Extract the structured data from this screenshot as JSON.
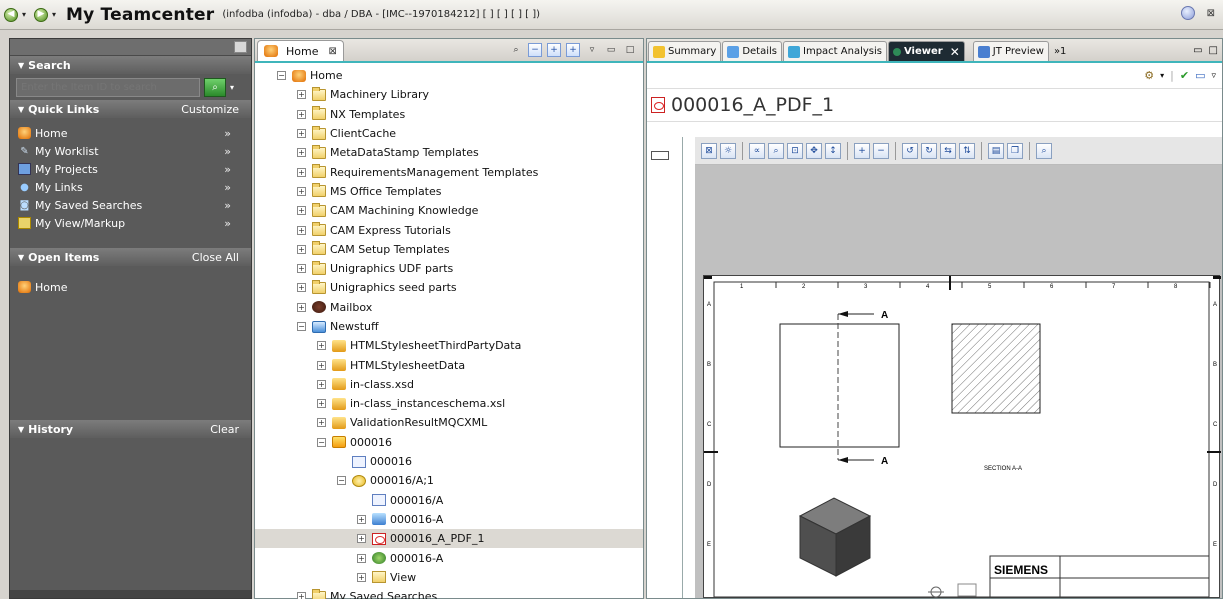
{
  "titlebar": {
    "app_title": "My Teamcenter",
    "subtitle": "(infodba (infodba) - dba / DBA - [IMC--1970184212] [ ] [ ] [ ] [ ])",
    "close_label": "⊠"
  },
  "leftnav": {
    "search": {
      "header": "Search",
      "placeholder": "Enter the Item ID to search"
    },
    "quick_links": {
      "header": "Quick Links",
      "action": "Customize",
      "items": [
        {
          "label": "Home",
          "icon": "home-icon"
        },
        {
          "label": "My Worklist",
          "icon": "worklist-icon"
        },
        {
          "label": "My Projects",
          "icon": "projects-icon"
        },
        {
          "label": "My Links",
          "icon": "links-icon"
        },
        {
          "label": "My Saved Searches",
          "icon": "saved-searches-icon"
        },
        {
          "label": "My View/Markup",
          "icon": "view-markup-icon"
        }
      ],
      "chevron": "»"
    },
    "open_items": {
      "header": "Open Items",
      "action": "Close All",
      "items": [
        {
          "label": "Home",
          "icon": "home-icon"
        }
      ]
    },
    "history": {
      "header": "History",
      "action": "Clear"
    }
  },
  "home_view": {
    "tab_label": "Home",
    "tab_close": "⊠",
    "tree": [
      {
        "level": 0,
        "toggle": "−",
        "icon": "home",
        "label": "Home"
      },
      {
        "level": 1,
        "toggle": "+",
        "icon": "folder",
        "label": "Machinery Library"
      },
      {
        "level": 1,
        "toggle": "+",
        "icon": "folder",
        "label": "NX Templates"
      },
      {
        "level": 1,
        "toggle": "+",
        "icon": "folder",
        "label": "ClientCache"
      },
      {
        "level": 1,
        "toggle": "+",
        "icon": "folder",
        "label": "MetaDataStamp Templates"
      },
      {
        "level": 1,
        "toggle": "+",
        "icon": "folder",
        "label": "RequirementsManagement Templates"
      },
      {
        "level": 1,
        "toggle": "+",
        "icon": "folder",
        "label": "MS Office Templates"
      },
      {
        "level": 1,
        "toggle": "+",
        "icon": "folder",
        "label": "CAM Machining Knowledge"
      },
      {
        "level": 1,
        "toggle": "+",
        "icon": "folder",
        "label": "CAM Express Tutorials"
      },
      {
        "level": 1,
        "toggle": "+",
        "icon": "folder",
        "label": "CAM Setup Templates"
      },
      {
        "level": 1,
        "toggle": "+",
        "icon": "folder",
        "label": "Unigraphics UDF parts"
      },
      {
        "level": 1,
        "toggle": "+",
        "icon": "folder",
        "label": "Unigraphics seed parts"
      },
      {
        "level": 1,
        "toggle": "+",
        "icon": "mail",
        "label": "Mailbox"
      },
      {
        "level": 1,
        "toggle": "−",
        "icon": "news",
        "label": "Newstuff"
      },
      {
        "level": 2,
        "toggle": "+",
        "icon": "stack",
        "label": "HTMLStylesheetThirdPartyData"
      },
      {
        "level": 2,
        "toggle": "+",
        "icon": "stack",
        "label": "HTMLStylesheetData"
      },
      {
        "level": 2,
        "toggle": "+",
        "icon": "stack",
        "label": "in-class.xsd"
      },
      {
        "level": 2,
        "toggle": "+",
        "icon": "stack",
        "label": "in-class_instanceschema.xsl"
      },
      {
        "level": 2,
        "toggle": "+",
        "icon": "stack",
        "label": "ValidationResultMQCXML"
      },
      {
        "level": 2,
        "toggle": "−",
        "icon": "item",
        "label": "000016"
      },
      {
        "level": 3,
        "toggle": "",
        "icon": "form",
        "label": "000016"
      },
      {
        "level": 3,
        "toggle": "−",
        "icon": "rev",
        "label": "000016/A;1"
      },
      {
        "level": 4,
        "toggle": "",
        "icon": "form",
        "label": "000016/A"
      },
      {
        "level": 4,
        "toggle": "+",
        "icon": "dataset",
        "label": "000016-A"
      },
      {
        "level": 4,
        "toggle": "+",
        "icon": "pdf",
        "label": "000016_A_PDF_1",
        "selected": true
      },
      {
        "level": 4,
        "toggle": "+",
        "icon": "jt",
        "label": "000016-A"
      },
      {
        "level": 4,
        "toggle": "+",
        "icon": "view",
        "label": "View"
      },
      {
        "level": 1,
        "toggle": "+",
        "icon": "folder",
        "label": "My Saved Searches"
      }
    ]
  },
  "editor": {
    "tabs": [
      {
        "label": "Summary",
        "active": false
      },
      {
        "label": "Details",
        "active": false
      },
      {
        "label": "Impact Analysis",
        "active": false
      },
      {
        "label": "Viewer",
        "active": true
      },
      {
        "label": "JT Preview",
        "active": false
      }
    ],
    "overflow_label": "»1",
    "active_close": "✕",
    "document_title": "000016_A_PDF_1",
    "drawing": {
      "section_label_top": "A",
      "section_label_bottom": "A",
      "section_caption": "SECTION A-A",
      "company": "SIEMENS",
      "col_numbers": [
        "1",
        "2",
        "3",
        "4",
        "5",
        "6",
        "7",
        "8"
      ],
      "row_letters": [
        "A",
        "B",
        "C",
        "D",
        "E"
      ]
    }
  },
  "colors": {
    "accent_teal": "#3fb5bb",
    "nav_bg": "#5a5a5a",
    "selection": "#dcd9d3",
    "active_tab": "#1e2b33"
  }
}
